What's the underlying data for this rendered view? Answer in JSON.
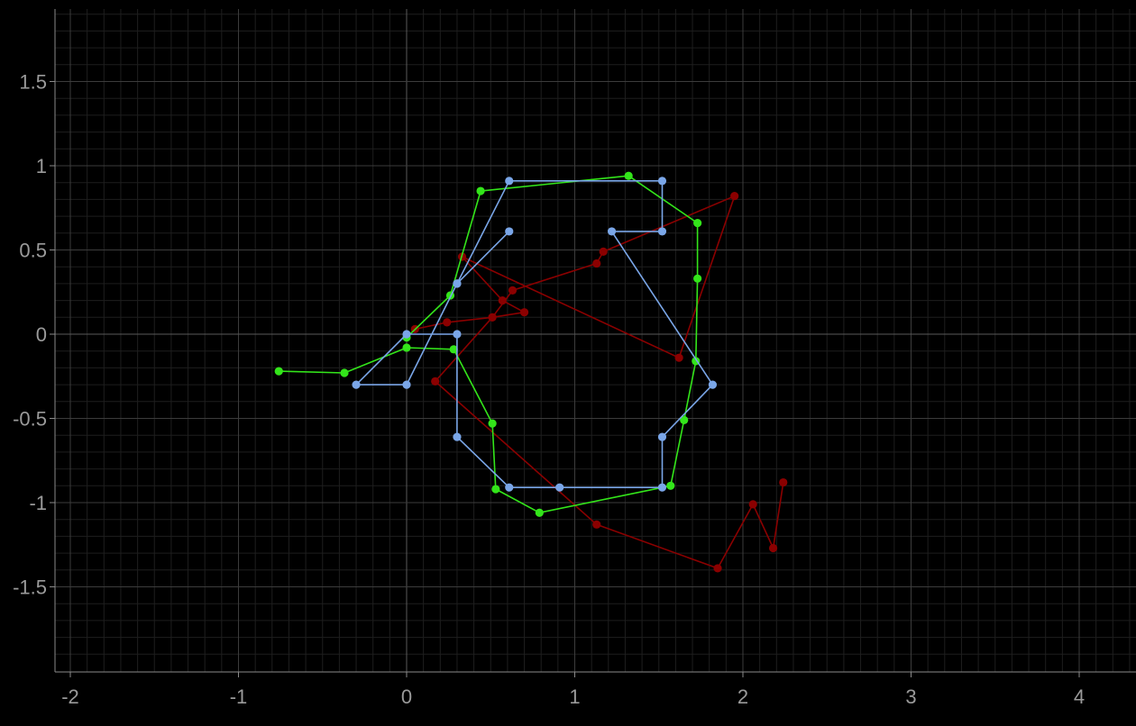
{
  "chart_data": {
    "type": "line",
    "title": "",
    "xlabel": "",
    "ylabel": "",
    "xlim": [
      -2.1,
      4.3
    ],
    "ylim": [
      -2.05,
      1.95
    ],
    "grid": true,
    "x_ticks": [
      -2,
      -1,
      0,
      1,
      2,
      3,
      4
    ],
    "x_tick_labels": [
      "-2",
      "-1",
      "0",
      "1",
      "2",
      "3",
      "4"
    ],
    "y_ticks": [
      1.5,
      1,
      0.5,
      0,
      -0.5,
      -1,
      -1.5
    ],
    "y_tick_labels": [
      "1.5",
      "1",
      "0.5",
      "0",
      "-0.5",
      "-1",
      "-1.5"
    ],
    "series": [
      {
        "color": "#8b0000",
        "points": [
          [
            0.05,
            0.03
          ],
          [
            0.24,
            0.07
          ],
          [
            0.51,
            0.1
          ],
          [
            0.7,
            0.13
          ],
          [
            0.57,
            0.2
          ],
          [
            0.33,
            0.46
          ],
          [
            1.62,
            -0.14
          ],
          [
            1.95,
            0.82
          ],
          [
            1.17,
            0.49
          ],
          [
            1.13,
            0.42
          ],
          [
            0.63,
            0.26
          ],
          [
            0.51,
            0.1
          ],
          [
            0.17,
            -0.28
          ],
          [
            1.13,
            -1.13
          ],
          [
            1.85,
            -1.39
          ],
          [
            2.06,
            -1.01
          ],
          [
            2.18,
            -1.27
          ],
          [
            2.24,
            -0.88
          ]
        ]
      },
      {
        "color": "#33e51a",
        "points": [
          [
            -0.76,
            -0.22
          ],
          [
            -0.37,
            -0.23
          ],
          [
            0.0,
            -0.08
          ],
          [
            0.28,
            -0.09
          ],
          [
            0.51,
            -0.53
          ],
          [
            0.53,
            -0.92
          ],
          [
            0.79,
            -1.06
          ],
          [
            1.57,
            -0.9
          ],
          [
            1.65,
            -0.51
          ],
          [
            1.72,
            -0.16
          ],
          [
            1.73,
            0.33
          ],
          [
            1.73,
            0.66
          ],
          [
            1.32,
            0.94
          ],
          [
            0.44,
            0.85
          ],
          [
            0.26,
            0.23
          ],
          [
            0.0,
            -0.02
          ]
        ]
      },
      {
        "color": "#7aa6e8",
        "points": [
          [
            0.61,
            0.61
          ],
          [
            0.3,
            0.3
          ],
          [
            0.0,
            -0.3
          ],
          [
            -0.3,
            -0.3
          ],
          [
            0.0,
            0.0
          ],
          [
            0.3,
            0.0
          ],
          [
            0.3,
            -0.61
          ],
          [
            0.61,
            -0.91
          ],
          [
            0.91,
            -0.91
          ],
          [
            1.52,
            -0.91
          ],
          [
            1.52,
            -0.61
          ],
          [
            1.82,
            -0.3
          ],
          [
            1.22,
            0.61
          ],
          [
            1.52,
            0.61
          ],
          [
            1.52,
            0.91
          ],
          [
            0.61,
            0.91
          ],
          [
            0.3,
            0.3
          ]
        ]
      }
    ]
  }
}
